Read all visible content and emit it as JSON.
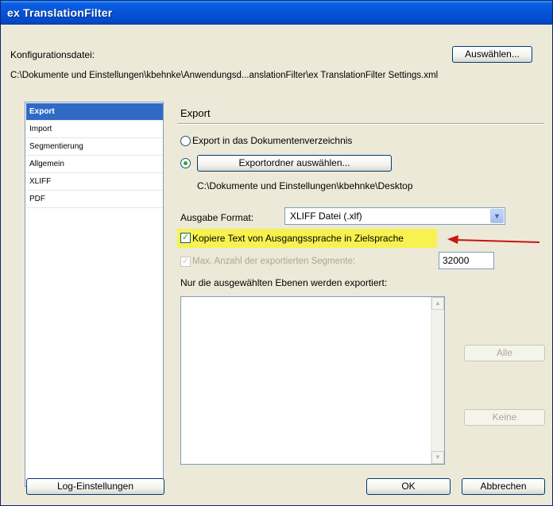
{
  "window": {
    "title": "ex TranslationFilter"
  },
  "config": {
    "label": "Konfigurationsdatei:",
    "path": "C:\\Dokumente und Einstellungen\\kbehnke\\Anwendungsd...anslationFilter\\ex TranslationFilter Settings.xml",
    "select_button": "Auswählen..."
  },
  "nav": {
    "items": [
      {
        "label": "Export",
        "selected": true
      },
      {
        "label": "Import",
        "selected": false
      },
      {
        "label": "Segmentierung",
        "selected": false
      },
      {
        "label": "Allgemein",
        "selected": false
      },
      {
        "label": "XLIFF",
        "selected": false
      },
      {
        "label": "PDF",
        "selected": false
      }
    ]
  },
  "panel": {
    "title": "Export",
    "radio_doc_dir": "Export in das Dokumentenverzeichnis",
    "export_folder_button": "Exportordner auswählen...",
    "export_folder_path": "C:\\Dokumente und Einstellungen\\kbehnke\\Desktop",
    "format_label": "Ausgabe Format:",
    "format_value": "XLIFF Datei (.xlf)",
    "copy_source_label": "Kopiere Text von Ausgangssprache in Zielsprache",
    "copy_source_checked": true,
    "max_segments_label": "Max. Anzahl der exportierten Segmente:",
    "max_segments_value": "32000",
    "layers_label": "Nur die ausgewählten Ebenen werden exportiert:",
    "all_button": "Alle",
    "none_button": "Keine"
  },
  "footer": {
    "log_button": "Log-Einstellungen",
    "ok_button": "OK",
    "cancel_button": "Abbrechen"
  },
  "colors": {
    "titlebar": "#0553d8",
    "highlight": "#f7f250",
    "arrow": "#c81414",
    "selection": "#316ac5"
  }
}
